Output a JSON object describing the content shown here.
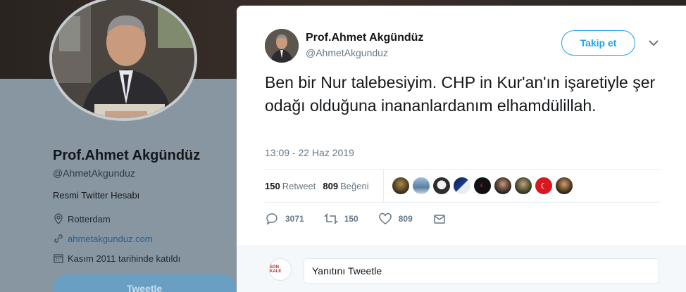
{
  "profile": {
    "name": "Prof.Ahmet Akgündüz",
    "handle": "@AhmetAkgunduz",
    "bio": "Resmi Twitter Hesabı",
    "location": "Rotterdam",
    "website": "ahmetakgunduz.com",
    "joined": "Kasım 2011 tarihinde katıldı",
    "tweet_button": "Tweetle"
  },
  "tweet": {
    "author_name": "Prof.Ahmet Akgündüz",
    "author_handle": "@AhmetAkgunduz",
    "follow_label": "Takip et",
    "text": "Ben bir Nur talebesiyim. CHP in Kur'an'ın işaretiyle şer odağı olduğuna inananlardanım elhamdülillah.",
    "timestamp": "13:09 - 22 Haz 2019",
    "retweet_count": "150",
    "retweet_label": "Retweet",
    "like_count": "809",
    "like_label": "Beğeni",
    "actions": {
      "reply_count": "3071",
      "retweet_count": "150",
      "like_count": "809"
    }
  },
  "reply": {
    "avatar_text": "SON KALE",
    "placeholder": "Yanıtını Tweetle"
  },
  "colors": {
    "accent": "#1da1f2",
    "text_secondary": "#657786"
  }
}
